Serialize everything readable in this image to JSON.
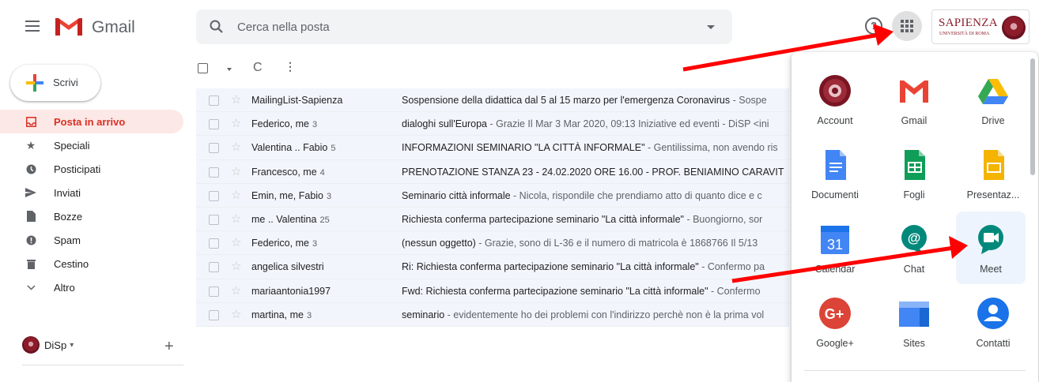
{
  "header": {
    "brand": "Gmail",
    "search_placeholder": "Cerca nella posta",
    "org_logo": {
      "title": "SAPIENZA",
      "subtitle": "UNIVERSITÀ DI ROMA"
    }
  },
  "sidebar": {
    "compose_label": "Scrivi",
    "items": [
      {
        "label": "Posta in arrivo",
        "icon": "inbox-icon",
        "active": true
      },
      {
        "label": "Speciali",
        "icon": "star-icon"
      },
      {
        "label": "Posticipati",
        "icon": "clock-icon"
      },
      {
        "label": "Inviati",
        "icon": "send-icon"
      },
      {
        "label": "Bozze",
        "icon": "draft-icon"
      },
      {
        "label": "Spam",
        "icon": "spam-icon"
      },
      {
        "label": "Cestino",
        "icon": "trash-icon"
      },
      {
        "label": "Altro",
        "icon": "chevron-down-icon"
      }
    ],
    "account_label": "DiSp",
    "account_caret": "▾",
    "add_label": "+"
  },
  "toolbar": {
    "refresh_glyph": "C",
    "more_glyph": "⋮"
  },
  "emails": [
    {
      "sender": "MailingList-Sapienza",
      "count": "",
      "subject": "Sospensione della didattica dal 5 al 15 marzo per l'emergenza Coronavirus",
      "snippet": " - Sospe"
    },
    {
      "sender": "Federico, me",
      "count": "3",
      "subject": "dialoghi sull'Europa",
      "snippet": " - Grazie Il Mar 3 Mar 2020, 09:13 Iniziative ed eventi - DiSP <ini"
    },
    {
      "sender": "Valentina .. Fabio",
      "count": "5",
      "subject": "INFORMAZIONI SEMINARIO \"LA CITTÀ INFORMALE\"",
      "snippet": " - Gentilissima, non avendo ris"
    },
    {
      "sender": "Francesco, me",
      "count": "4",
      "subject": "PRENOTAZIONE STANZA 23 - 24.02.2020 ORE 16.00 - PROF. BENIAMINO CARAVIT",
      "snippet": ""
    },
    {
      "sender": "Emin, me, Fabio",
      "count": "3",
      "subject": "Seminario città informale",
      "snippet": " - Nicola, rispondile che prendiamo atto di quanto dice e c"
    },
    {
      "sender": "me .. Valentina",
      "count": "25",
      "subject": "Richiesta conferma partecipazione seminario \"La città informale\"",
      "snippet": " - Buongiorno, sor"
    },
    {
      "sender": "Federico, me",
      "count": "3",
      "subject": "(nessun oggetto)",
      "snippet": " - Grazie, sono di L-36 e il numero di matricola è 1868766 Il 5/13"
    },
    {
      "sender": "angelica silvestri",
      "count": "",
      "subject": "Ri: Richiesta conferma partecipazione seminario \"La città informale\"",
      "snippet": " - Confermo pa"
    },
    {
      "sender": "mariaantonia1997",
      "count": "",
      "subject": "Fwd: Richiesta conferma partecipazione seminario \"La città informale\"",
      "snippet": " - Confermo"
    },
    {
      "sender": "martina, me",
      "count": "3",
      "subject": "seminario",
      "snippet": " - evidentemente ho dei problemi con l'indirizzo perchè non è la prima vol"
    }
  ],
  "apps_panel": {
    "apps": [
      {
        "label": "Account",
        "icon": "account-seal-icon"
      },
      {
        "label": "Gmail",
        "icon": "gmail-icon"
      },
      {
        "label": "Drive",
        "icon": "drive-icon"
      },
      {
        "label": "Documenti",
        "icon": "docs-icon"
      },
      {
        "label": "Fogli",
        "icon": "sheets-icon"
      },
      {
        "label": "Presentaz...",
        "icon": "slides-icon"
      },
      {
        "label": "Calendar",
        "icon": "calendar-icon",
        "day": "31"
      },
      {
        "label": "Chat",
        "icon": "chat-icon"
      },
      {
        "label": "Meet",
        "icon": "meet-icon",
        "highlighted": true
      },
      {
        "label": "Google+",
        "icon": "google-plus-icon"
      },
      {
        "label": "Sites",
        "icon": "sites-icon"
      },
      {
        "label": "Contatti",
        "icon": "contacts-icon"
      }
    ]
  },
  "colors": {
    "accent_red": "#d93025",
    "annotation_arrow": "#ff0000",
    "row_bg": "#f2f6fc"
  }
}
